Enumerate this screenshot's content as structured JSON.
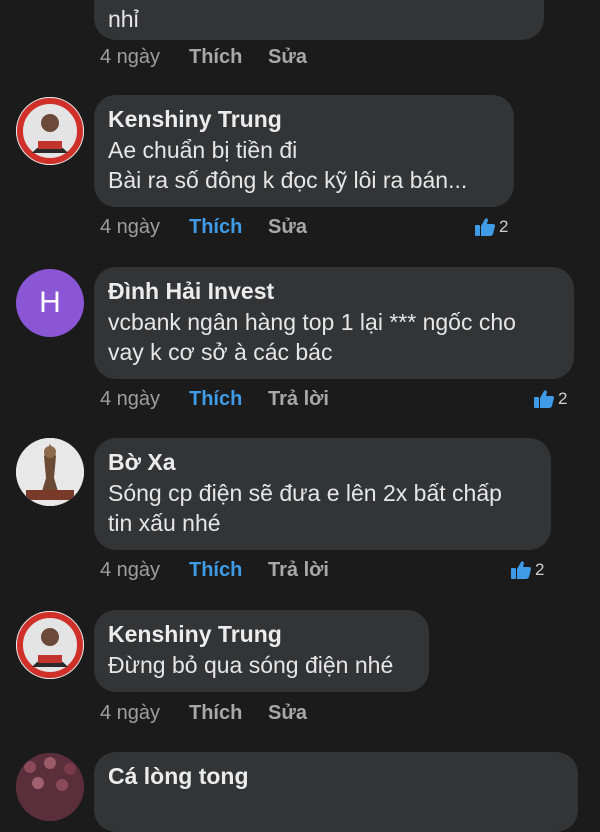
{
  "top_comment": {
    "text_tail": "nhỉ",
    "time": "4 ngày",
    "like_label": "Thích",
    "action_label": "Sửa"
  },
  "comments": [
    {
      "author": "Kenshiny Trung",
      "text": "Ae chuẩn bị tiền đi\nBài ra số đông k đọc kỹ lôi ra bán...",
      "time": "4 ngày",
      "like_label": "Thích",
      "action_label": "Sửa",
      "likes": "2",
      "liked": true
    },
    {
      "author": "Đình Hải Invest",
      "avatar_letter": "H",
      "avatar_color": "#8a56d6",
      "text": "vcbank ngân hàng top 1 lại *** ngốc cho\nvay k cơ sở à các bác",
      "time": "4 ngày",
      "like_label": "Thích",
      "action_label": "Trả lời",
      "likes": "2",
      "liked": true
    },
    {
      "author": "Bờ Xa",
      "text": "Sóng cp điện sẽ đưa e lên 2x bất chấp\ntin xấu nhé",
      "time": "4 ngày",
      "like_label": "Thích",
      "action_label": "Trả lời",
      "likes": "2",
      "liked": true
    },
    {
      "author": "Kenshiny Trung",
      "text": "Đừng bỏ qua sóng điện nhé",
      "time": "4 ngày",
      "like_label": "Thích",
      "action_label": "Sửa",
      "liked": false
    },
    {
      "author": "Cá lòng tong"
    }
  ],
  "colors": {
    "background": "#1b1b1b",
    "bubble": "#333436",
    "like_active": "#3f9be6",
    "meta_text": "#9e9e9e"
  }
}
